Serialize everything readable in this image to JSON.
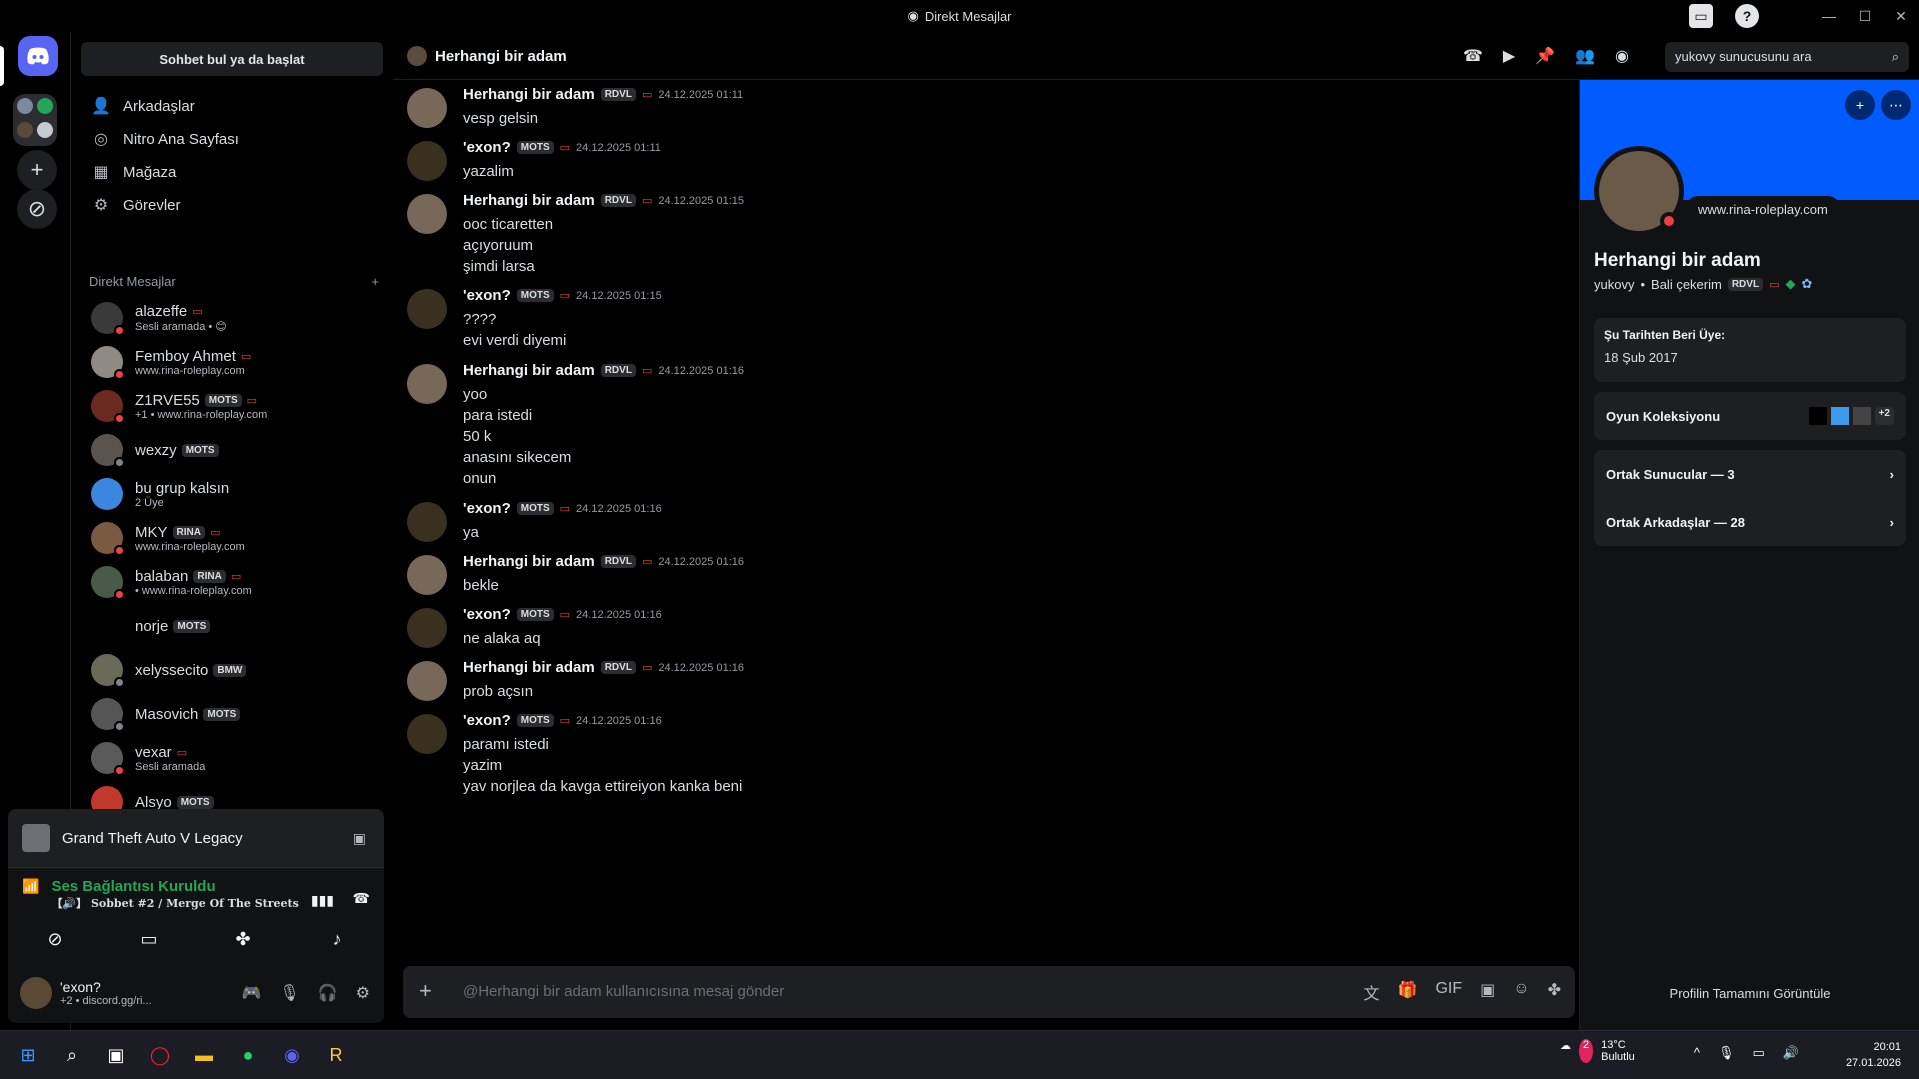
{
  "window": {
    "title": "Direkt Mesajlar"
  },
  "sidebar": {
    "search_label": "Sohbet bul ya da başlat",
    "nav": [
      "Arkadaşlar",
      "Nitro Ana Sayfası",
      "Mağaza",
      "Görevler"
    ],
    "dm_header": "Direkt Mesajlar",
    "dms": [
      {
        "name": "alazeffe",
        "sub": "Sesli aramada • 😊",
        "tag": ""
      },
      {
        "name": "Femboy Ahmet",
        "sub": "www.rina-roleplay.com",
        "tag": ""
      },
      {
        "name": "Z1RVE55",
        "sub": "+1 • www.rina-roleplay.com",
        "tag": "MOTS"
      },
      {
        "name": "wexzy",
        "sub": "",
        "tag": "MOTS"
      },
      {
        "name": "bu grup kalsın",
        "sub": "2 Üye",
        "tag": ""
      },
      {
        "name": "MKY",
        "sub": "www.rina-roleplay.com",
        "tag": "RINA"
      },
      {
        "name": "balaban",
        "sub": "• www.rina-roleplay.com",
        "tag": "RINA"
      },
      {
        "name": "norje",
        "sub": "",
        "tag": "MOTS"
      },
      {
        "name": "xelyssecito",
        "sub": "",
        "tag": "BMW"
      },
      {
        "name": "Masovich",
        "sub": "",
        "tag": "MOTS"
      },
      {
        "name": "vexar",
        "sub": "Sesli aramada",
        "tag": ""
      },
      {
        "name": "Alsyo",
        "sub": "",
        "tag": "MOTS"
      }
    ]
  },
  "activity": {
    "game": "Grand Theft Auto V Legacy"
  },
  "voice": {
    "status": "Ses Bağlantısı Kuruldu",
    "channel": "【🔊】 Sobbet #2 / Merge Of The Streets"
  },
  "user": {
    "name": "'exon?",
    "sub": "+2 • discord.gg/ri..."
  },
  "chat": {
    "recipient": "Herhangi bir adam",
    "search_placeholder": "yukovy sunucusunu ara",
    "composer_placeholder": "@Herhangi bir adam kullanıcısına mesaj gönder",
    "messages": [
      {
        "author": "Herhangi bir adam",
        "tag": "RDVL",
        "time": "24.12.2025 01:11",
        "lines": [
          "vesp gelsin"
        ]
      },
      {
        "author": "'exon?",
        "tag": "MOTS",
        "time": "24.12.2025 01:11",
        "lines": [
          "yazalim"
        ]
      },
      {
        "author": "Herhangi bir adam",
        "tag": "RDVL",
        "time": "24.12.2025 01:15",
        "lines": [
          "ooc ticaretten",
          "açıyoruum",
          "şimdi larsa"
        ]
      },
      {
        "author": "'exon?",
        "tag": "MOTS",
        "time": "24.12.2025 01:15",
        "lines": [
          "????",
          "evi verdi diyemi"
        ]
      },
      {
        "author": "Herhangi bir adam",
        "tag": "RDVL",
        "time": "24.12.2025 01:16",
        "lines": [
          "yoo",
          "para istedi",
          "50 k",
          "anasını sikecem",
          "onun"
        ]
      },
      {
        "author": "'exon?",
        "tag": "MOTS",
        "time": "24.12.2025 01:16",
        "lines": [
          "ya"
        ]
      },
      {
        "author": "Herhangi bir adam",
        "tag": "RDVL",
        "time": "24.12.2025 01:16",
        "lines": [
          "bekle"
        ]
      },
      {
        "author": "'exon?",
        "tag": "MOTS",
        "time": "24.12.2025 01:16",
        "lines": [
          "ne alaka aq"
        ]
      },
      {
        "author": "Herhangi bir adam",
        "tag": "RDVL",
        "time": "24.12.2025 01:16",
        "lines": [
          "prob açsın"
        ]
      },
      {
        "author": "'exon?",
        "tag": "MOTS",
        "time": "24.12.2025 01:16",
        "lines": [
          "paramı istedi",
          "yazim",
          "yav norjlea da kavga ettireiyon kanka beni"
        ]
      }
    ]
  },
  "profile": {
    "status_bubble": "www.rina-roleplay.com",
    "name": "Herhangi bir adam",
    "username": "yukovy",
    "pronoun": "Bali çekerim",
    "tag": "RDVL",
    "member_since_label": "Şu Tarihten Beri Üye:",
    "member_since": "18 Şub 2017",
    "game_collection_label": "Oyun Koleksiyonu",
    "game_collection_more": "+2",
    "mutual_servers": "Ortak Sunucular — 3",
    "mutual_friends": "Ortak Arkadaşlar — 28",
    "view_full": "Profilin Tamamını Görüntüle"
  },
  "taskbar": {
    "weather_temp": "13°C",
    "weather_desc": "Bulutlu",
    "weather_badge": "2",
    "time": "20:01",
    "date": "27.01.2026"
  }
}
